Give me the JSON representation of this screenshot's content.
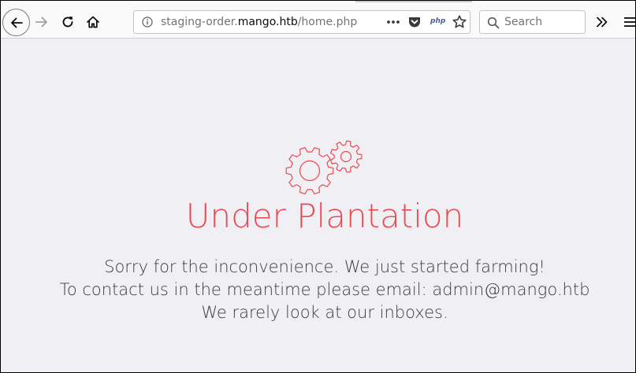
{
  "browser": {
    "url": {
      "prefix": "staging-order.",
      "host": "mango.htb",
      "path": "/home.php"
    },
    "php_badge": "php",
    "search": {
      "placeholder": "Search",
      "value": ""
    },
    "icons": {
      "back": "back-arrow-icon",
      "forward": "forward-arrow-icon",
      "reload": "reload-icon",
      "home": "home-icon",
      "info": "info-icon",
      "page_actions": "more-dots-icon",
      "pocket": "pocket-icon",
      "bookmark": "star-icon",
      "search": "search-icon",
      "overflow": "double-chevron-icon",
      "menu": "hamburger-menu-icon"
    }
  },
  "page": {
    "logo_icon": "gears-icon",
    "title": "Under Plantation",
    "message": {
      "line1": "Sorry for the inconvenience. We just started farming!",
      "line2": "To contact us in the meantime please email: admin@mango.htb",
      "line3": "We rarely look at our inboxes."
    },
    "colors": {
      "accent": "#ea4b52",
      "text": "#3c3c44",
      "background": "#efeff4"
    }
  }
}
